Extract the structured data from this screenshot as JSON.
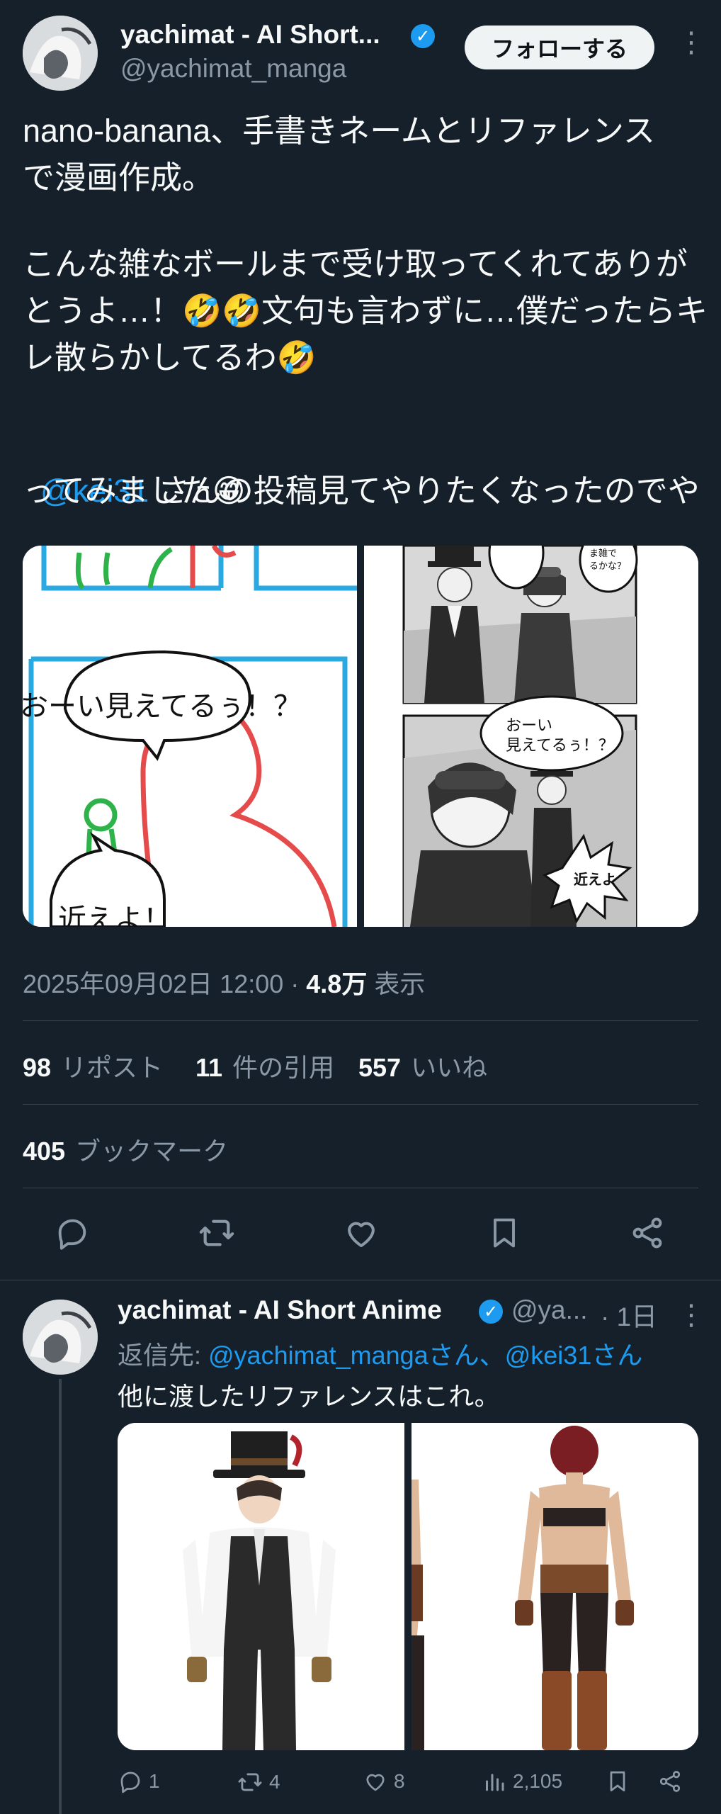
{
  "tweet": {
    "author_name": "yachimat - AI Short...",
    "author_handle": "@yachimat_manga",
    "follow_label": "フォローする",
    "text_line1": "nano-banana、手書きネームとリファレンス",
    "text_line2": "で漫画作成。",
    "text_line3": "こんな雑なボールまで受け取ってくれてありが",
    "text_line4": "とうよ…！🤣🤣文句も言わずに…僕だったらキ",
    "text_line5": "レ散らかしてるわ🤣",
    "mention": "@kei31",
    "text_line6_rest": " さんの投稿見てやりたくなったのでや",
    "text_line7": "ってみました😁",
    "sketch_bubble1": "おーい見えてるぅ！？",
    "sketch_bubble2": "近えよ！",
    "manga_bubble_top": "ま雑で\nるかな？",
    "manga_bubble_main": "おーい\n見えてるぅ！？",
    "manga_bubble_shout": "近えよ",
    "datetime": "2025年09月02日 12:00",
    "views_count": "4.8万",
    "views_label": "表示",
    "reposts_count": "98",
    "reposts_label": "リポスト",
    "quotes_count": "11",
    "quotes_label": "件の引用",
    "likes_count": "557",
    "likes_label": "いいね",
    "bookmarks_count": "405",
    "bookmarks_label": "ブックマーク"
  },
  "reply": {
    "author_name": "yachimat - AI Short Anime",
    "author_handle": "@ya...",
    "time": "· 1日",
    "reply_to_prefix": "返信先: ",
    "reply_to_user1": "@yachimat_manga",
    "reply_to_san1": "さん、",
    "reply_to_user2": "@kei31",
    "reply_to_san2": "さん",
    "text": "他に渡したリファレンスはこれ。",
    "replies": "1",
    "retweets": "4",
    "likes": "8",
    "views": "2,105"
  },
  "colors": {
    "background": "#15202b",
    "accent": "#1d9bf0",
    "muted": "#8b98a5",
    "divider": "#38444d"
  }
}
